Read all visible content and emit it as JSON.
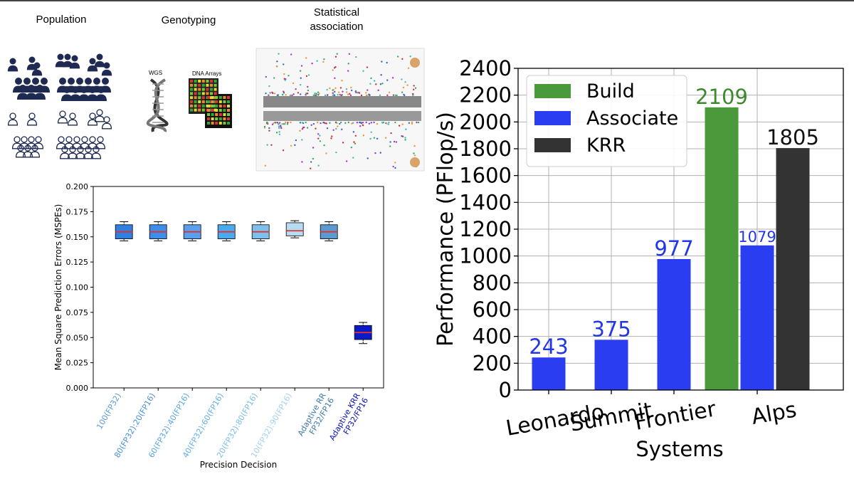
{
  "pipeline": {
    "stages": [
      {
        "label": "Population"
      },
      {
        "label": "Genotyping",
        "sub_labels": [
          "WGS",
          "DNA Arrays"
        ]
      },
      {
        "label": "Statistical\nassociation"
      }
    ]
  },
  "chart_data": [
    {
      "type": "box",
      "title": "",
      "xlabel": "Precision Decision",
      "ylabel": "Mean Square Prediction Errors (MSPEs)",
      "ylim": [
        0.0,
        0.2
      ],
      "yticks": [
        "0.000",
        "0.025",
        "0.050",
        "0.075",
        "0.100",
        "0.125",
        "0.150",
        "0.175",
        "0.200"
      ],
      "categories": [
        "100(FP32)",
        "80(FP32):20(FP16)",
        "60(FP32):40(FP16)",
        "40(FP32):60(FP16)",
        "20(FP32):80(FP16)",
        "10(FP32):90(FP16)",
        "Adaptive RR\nFP32/FP16",
        "Adaptive KRR\nFP32/FP16"
      ],
      "category_colors": [
        "#5b9bd5",
        "#4a90d9",
        "#5aa5e0",
        "#62b0e8",
        "#78bde8",
        "#a5d0ee",
        "#3f78a8",
        "#0a12b0"
      ],
      "boxes": [
        {
          "whisker_low": 0.146,
          "q1": 0.148,
          "median": 0.155,
          "q3": 0.162,
          "whisker_high": 0.165,
          "fill": "#2f80e0"
        },
        {
          "whisker_low": 0.146,
          "q1": 0.148,
          "median": 0.155,
          "q3": 0.162,
          "whisker_high": 0.165,
          "fill": "#3d8ee8"
        },
        {
          "whisker_low": 0.146,
          "q1": 0.148,
          "median": 0.155,
          "q3": 0.162,
          "whisker_high": 0.165,
          "fill": "#5aa0ee"
        },
        {
          "whisker_low": 0.146,
          "q1": 0.148,
          "median": 0.155,
          "q3": 0.162,
          "whisker_high": 0.165,
          "fill": "#4aaaf0"
        },
        {
          "whisker_low": 0.146,
          "q1": 0.148,
          "median": 0.155,
          "q3": 0.162,
          "whisker_high": 0.165,
          "fill": "#7cc0ee"
        },
        {
          "whisker_low": 0.149,
          "q1": 0.151,
          "median": 0.156,
          "q3": 0.164,
          "whisker_high": 0.166,
          "fill": "#b5dcf2"
        },
        {
          "whisker_low": 0.146,
          "q1": 0.148,
          "median": 0.155,
          "q3": 0.162,
          "whisker_high": 0.165,
          "fill": "#5a9ad0"
        },
        {
          "whisker_low": 0.044,
          "q1": 0.048,
          "median": 0.055,
          "q3": 0.062,
          "whisker_high": 0.065,
          "fill": "#0a1ac8"
        }
      ],
      "median_color": "#e03030",
      "grid": false
    },
    {
      "type": "bar",
      "title": "",
      "xlabel": "Systems",
      "ylabel": "Performance (PFlop/s)",
      "ylim": [
        0,
        2400
      ],
      "yticks": [
        "0",
        "200",
        "400",
        "600",
        "800",
        "1000",
        "1200",
        "1400",
        "1600",
        "1800",
        "2000",
        "2200",
        "2400"
      ],
      "categories": [
        "Leonardo",
        "Summit",
        "Frontier",
        "Alps"
      ],
      "series": [
        {
          "name": "Build",
          "color": "#4a9a3c",
          "values": [
            null,
            null,
            null,
            2109
          ]
        },
        {
          "name": "Associate",
          "color": "#2b3df0",
          "values": [
            243,
            375,
            977,
            1079
          ]
        },
        {
          "name": "KRR",
          "color": "#333333",
          "values": [
            null,
            null,
            null,
            1805
          ]
        }
      ],
      "data_labels": [
        {
          "text": "243",
          "series": "Associate",
          "category": "Leonardo"
        },
        {
          "text": "375",
          "series": "Associate",
          "category": "Summit"
        },
        {
          "text": "977",
          "series": "Associate",
          "category": "Frontier"
        },
        {
          "text": "2109",
          "series": "Build",
          "category": "Alps"
        },
        {
          "text": "1079",
          "series": "Associate",
          "category": "Alps"
        },
        {
          "text": "1805",
          "series": "KRR",
          "category": "Alps"
        }
      ],
      "legend_position": "top-left",
      "grid": true
    }
  ]
}
